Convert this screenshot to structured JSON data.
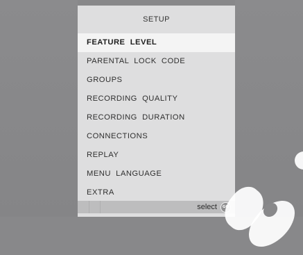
{
  "panel": {
    "title": "SETUP"
  },
  "menu": {
    "items": [
      {
        "label": "FEATURE  LEVEL",
        "selected": true
      },
      {
        "label": "PARENTAL  LOCK  CODE",
        "selected": false
      },
      {
        "label": "GROUPS",
        "selected": false
      },
      {
        "label": "RECORDING  QUALITY",
        "selected": false
      },
      {
        "label": "RECORDING  DURATION",
        "selected": false
      },
      {
        "label": "CONNECTIONS",
        "selected": false
      },
      {
        "label": "REPLAY",
        "selected": false
      },
      {
        "label": "MENU  LANGUAGE",
        "selected": false
      },
      {
        "label": "EXTRA",
        "selected": false
      }
    ]
  },
  "footer": {
    "hint_text": "select",
    "go_icon_name": "go-button-icon",
    "go_icon_text": "GO"
  },
  "colors": {
    "background": "#88888a",
    "panel": "#dededf",
    "selected_row": "#f4f4f4",
    "footer_bar": "#bdbdbe"
  }
}
